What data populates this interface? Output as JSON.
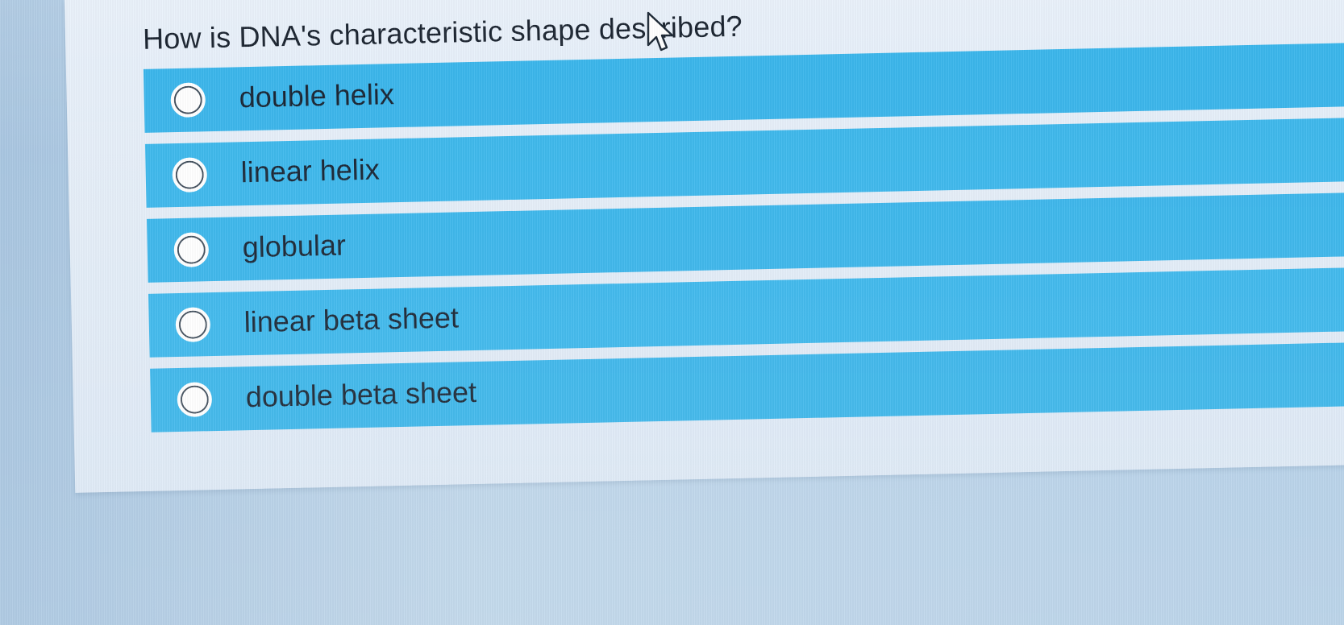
{
  "question": {
    "text": "How is DNA's characteristic shape described?"
  },
  "options": [
    {
      "label": "double helix",
      "selected": false,
      "radio_icon": "radio-button-icon"
    },
    {
      "label": "linear helix",
      "selected": false,
      "radio_icon": "radio-button-icon"
    },
    {
      "label": "globular",
      "selected": false,
      "radio_icon": "radio-button-icon"
    },
    {
      "label": "linear beta sheet",
      "selected": false,
      "radio_icon": "radio-button-icon"
    },
    {
      "label": "double beta sheet",
      "selected": false,
      "radio_icon": "radio-button-icon"
    }
  ],
  "colors": {
    "option_background": "#39b5eb",
    "question_text": "#1b2430",
    "panel_background": "#e9f1fa"
  },
  "icons": {
    "cursor": "mouse-pointer-icon"
  }
}
